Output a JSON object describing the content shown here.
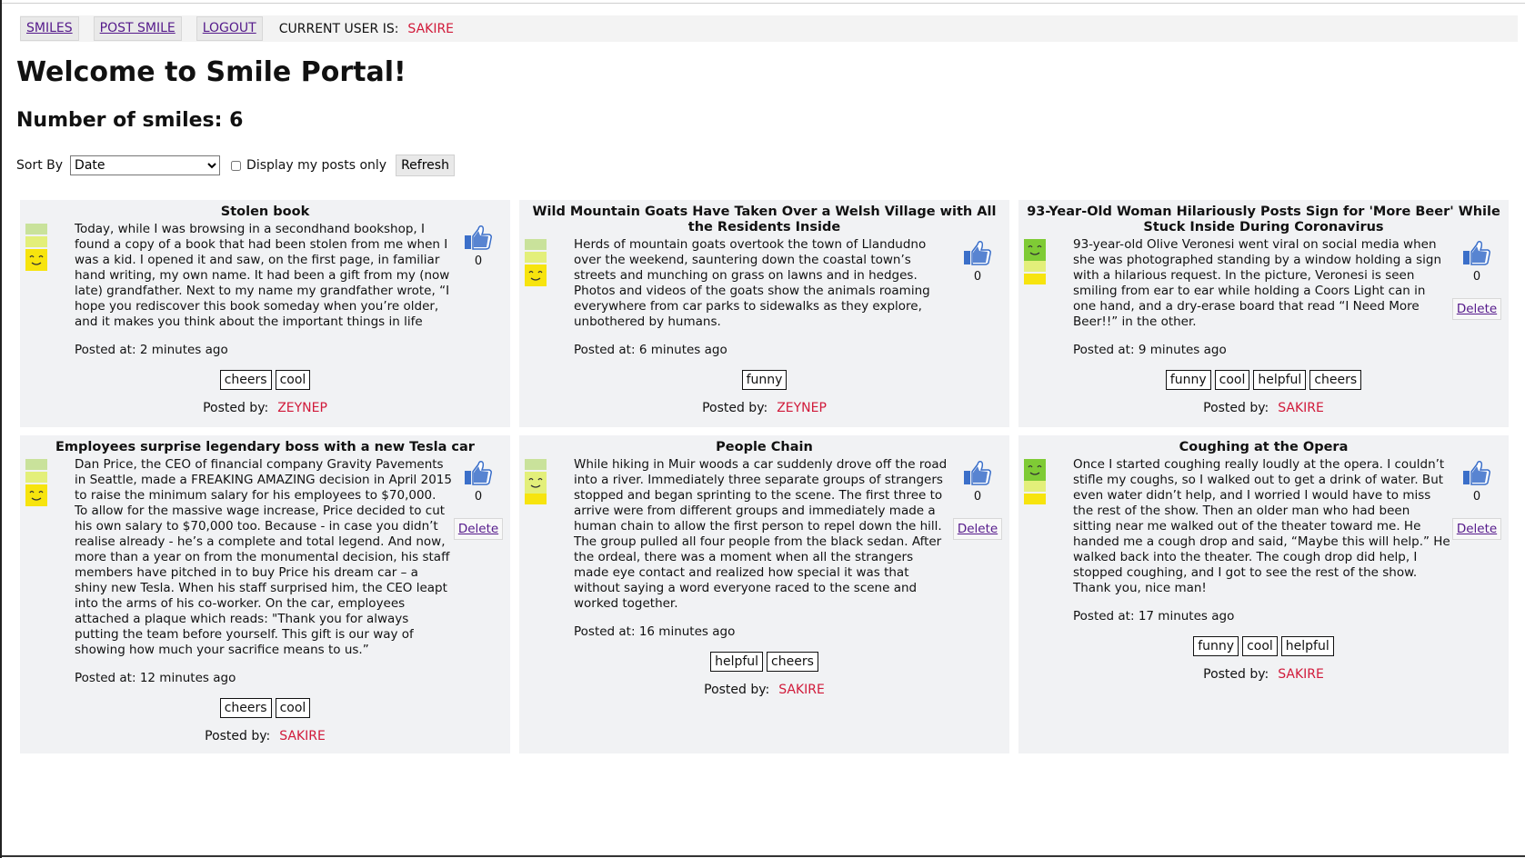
{
  "nav": {
    "smiles_label": "SMILES",
    "post_smile_label": "POST SMILE",
    "logout_label": "LOGOUT",
    "current_user_label": "CURRENT USER IS:",
    "current_user": "SAKIRE"
  },
  "page": {
    "title": "Welcome to Smile Portal!",
    "count_label": "Number of smiles: 6"
  },
  "controls": {
    "sort_label": "Sort By",
    "sort_selected": "Date",
    "my_posts_label": "Display my posts only",
    "refresh_label": "Refresh"
  },
  "colors": {
    "mood_light": "#c9e29b",
    "mood_mid": "#e3ef7a",
    "mood_yellow": "#f7e40e",
    "mood_green": "#7fcb35",
    "author": "#d11a3a",
    "like_icon": "#3b6fc9"
  },
  "labels": {
    "posted_by": "Posted by:",
    "delete": "Delete"
  },
  "smiles": [
    {
      "title": "Stolen book",
      "text": "Today, while I was browsing in a secondhand bookshop, I found a copy of a book that had been stolen from me when I was a kid. I opened it and saw, on the first page, in familiar hand writing, my own name. It had been a gift from my (now late) grandfather. Next to my name my grandfather wrote, “I hope you rediscover this book someday when you’re older, and it makes you think about the important things in life",
      "posted_at": "Posted at: 2 minutes ago",
      "tags": [
        "cheers",
        "cool"
      ],
      "author": "ZEYNEP",
      "likes": "0",
      "mood": "yellow",
      "deletable": false
    },
    {
      "title": "Wild Mountain Goats Have Taken Over a Welsh Village with All the Residents Inside",
      "text": "Herds of mountain goats overtook the town of Llandudno over the weekend, sauntering down the coastal town’s streets and munching on grass on lawns and in hedges. Photos and videos of the goats show the animals roaming everywhere from car parks to sidewalks as they explore, unbothered by humans.",
      "posted_at": "Posted at: 6 minutes ago",
      "tags": [
        "funny"
      ],
      "author": "ZEYNEP",
      "likes": "0",
      "mood": "yellow",
      "deletable": false
    },
    {
      "title": "93-Year-Old Woman Hilariously Posts Sign for 'More Beer' While Stuck Inside During Coronavirus",
      "text": "93-year-old Olive Veronesi went viral on social media when she was photographed standing by a window holding a sign with a hilarious request. In the picture, Veronesi is seen smiling from ear to ear while holding a Coors Light can in one hand, and a dry-erase board that read “I Need More Beer!!” in the other.",
      "posted_at": "Posted at: 9 minutes ago",
      "tags": [
        "funny",
        "cool",
        "helpful",
        "cheers"
      ],
      "author": "SAKIRE",
      "likes": "0",
      "mood": "green",
      "deletable": true
    },
    {
      "title": "Employees surprise legendary boss with a new Tesla car",
      "text": "Dan Price, the CEO of financial company Gravity Pavements in Seattle, made a FREAKING AMAZING decision in April 2015 to raise the minimum salary for his employees to $70,000. To allow for the massive wage increase, Price decided to cut his own salary to $70,000 too. Because - in case you didn’t realise already - he’s a complete and total legend. And now, more than a year on from the monumental decision, his staff members have pitched in to buy Price his dream car – a shiny new Tesla. When his staff surprised him, the CEO leapt into the arms of his co-worker. On the car, employees attached a plaque which reads: \"Thank you for always putting the team before yourself. This gift is our way of showing how much your sacrifice means to us.”",
      "posted_at": "Posted at: 12 minutes ago",
      "tags": [
        "cheers",
        "cool"
      ],
      "author": "SAKIRE",
      "likes": "0",
      "mood": "yellow",
      "deletable": true
    },
    {
      "title": "People Chain",
      "text": "While hiking in Muir woods a car suddenly drove off the road into a river. Immediately three separate groups of strangers stopped and began sprinting to the scene. The first three to arrive were from different groups and immediately made a human chain to allow the first person to repel down the hill. The group pulled all four people from the black sedan. After the ordeal, there was a moment when all the strangers made eye contact and realized how special it was that without saying a word everyone raced to the scene and worked together.",
      "posted_at": "Posted at: 16 minutes ago",
      "tags": [
        "helpful",
        "cheers"
      ],
      "author": "SAKIRE",
      "likes": "0",
      "mood": "mid",
      "deletable": true
    },
    {
      "title": "Coughing at the Opera",
      "text": "Once I started coughing really loudly at the opera. I couldn’t stifle my coughs, so I walked out to get a drink of water. But even water didn’t help, and I worried I would have to miss the rest of the show. Then an older man who had been sitting near me walked out of the theater toward me. He handed me a cough drop and said, “Maybe this will help.” He walked back into the theater. The cough drop did help, I stopped coughing, and I got to see the rest of the show. Thank you, nice man!",
      "posted_at": "Posted at: 17 minutes ago",
      "tags": [
        "funny",
        "cool",
        "helpful"
      ],
      "author": "SAKIRE",
      "likes": "0",
      "mood": "green",
      "deletable": true
    }
  ]
}
